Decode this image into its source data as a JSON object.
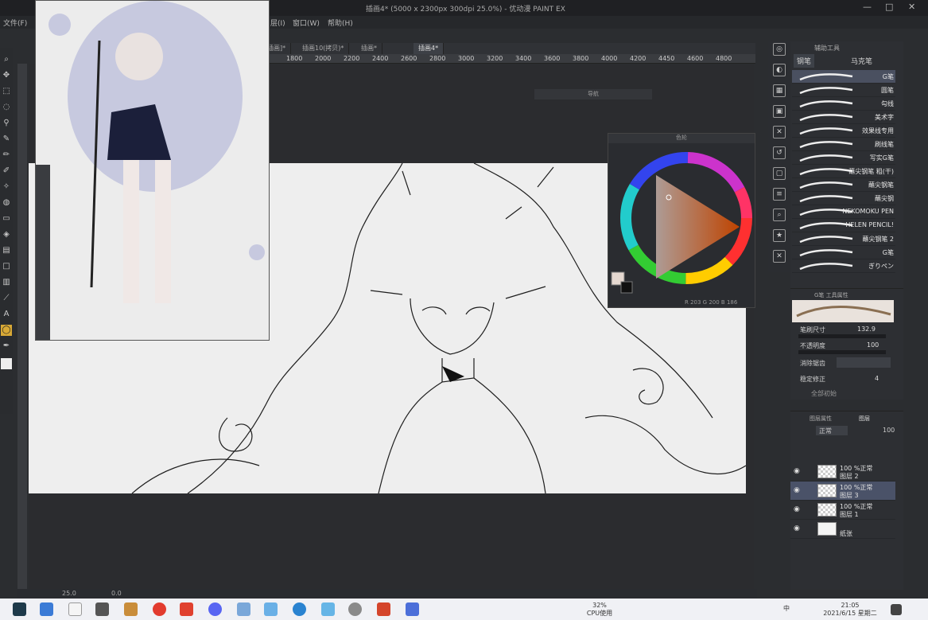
{
  "window": {
    "title": "插画4* (5000 x 2300px 300dpi 25.0%) - 优动漫 PAINT EX",
    "menu": [
      "文件(F)",
      "层(I)",
      "窗口(W)",
      "帮助(H)"
    ],
    "controls": [
      "—",
      "□",
      "✕"
    ]
  },
  "tabs": [
    "插画]*",
    "插画10(拷贝)*",
    "插画*",
    "插画4*"
  ],
  "ruler_ticks": [
    "1800",
    "2000",
    "2200",
    "2400",
    "2600",
    "2800",
    "3000",
    "3200",
    "3400",
    "3600",
    "3800",
    "4000",
    "4200",
    "4450",
    "4600",
    "4800"
  ],
  "floating_bar": {
    "label": "导航"
  },
  "color_panel": {
    "header": "色轮",
    "readout": "R 203  G 200  B 186"
  },
  "brush_panel": {
    "header": "辅助工具",
    "tabs": [
      "钢笔",
      "马克笔"
    ],
    "brushes": [
      "G笔",
      "圆笔",
      "勾线",
      "美术字",
      "效果线专用",
      "刷线笔",
      "写实G笔",
      "蘸尖钢笔 粗(干)",
      "蘸尖钢笔",
      "蘸尖钢",
      "NEKOMOKU PEN",
      "HELEN PENCIL!",
      "蘸尖钢笔 2",
      "G笔",
      "ぎりペン"
    ],
    "selected_index": 0
  },
  "tool_props": {
    "header": "G笔 工具属性",
    "rows": [
      {
        "label": "笔刷尺寸",
        "value": "132.9"
      },
      {
        "label": "不透明度",
        "value": "100"
      },
      {
        "label": "消除锯齿",
        "value": ""
      },
      {
        "label": "稳定修正",
        "value": "4"
      }
    ],
    "footer": "全部初始"
  },
  "layer_panel": {
    "tabs": [
      "图层属性",
      "图层"
    ],
    "blend_mode": "正常",
    "opacity": "100",
    "layers": [
      {
        "line1": "100 %正常",
        "line2": "图层 2"
      },
      {
        "line1": "100 %正常",
        "line2": "图层 3"
      },
      {
        "line1": "100 %正常",
        "line2": "图层 1"
      },
      {
        "line1": "",
        "line2": "纸张"
      }
    ],
    "selected_index": 1
  },
  "status": {
    "zoom": "25.0",
    "angle": "0.0"
  },
  "taskbar": {
    "cpu_label": "32%",
    "cpu_sub": "CPU使用",
    "time": "21:05",
    "date": "2021/6/15 星期二",
    "lang": "中"
  },
  "colors": {
    "accent_tool": "#d8a936",
    "selection": "#4a5268",
    "canvas": "#eeeeee",
    "panel": "#2d2f33"
  }
}
